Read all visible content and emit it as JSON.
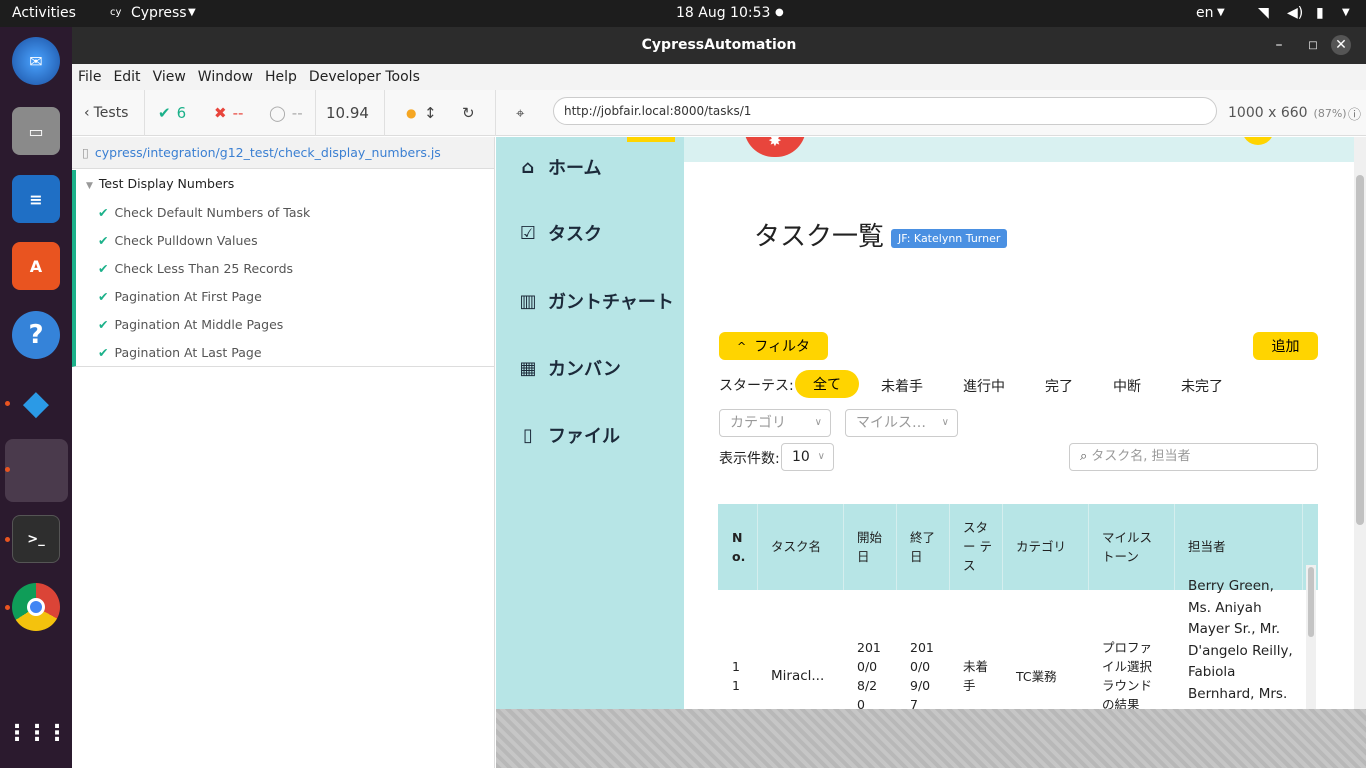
{
  "topbar": {
    "activities": "Activities",
    "app": "Cypress",
    "app_icon": "cy",
    "datetime": "18 Aug  10:53",
    "lang": "en"
  },
  "window": {
    "title": "CypressAutomation"
  },
  "menu": [
    "File",
    "Edit",
    "View",
    "Window",
    "Help",
    "Developer Tools"
  ],
  "toolbar": {
    "tests": "Tests",
    "passed": "6",
    "failed": "--",
    "pending": "--",
    "duration": "10.94",
    "url": "http://jobfair.local:8000/tasks/1",
    "viewport": "1000 x 660",
    "zoom": "(87%)"
  },
  "spec": {
    "path": "cypress/integration/g12_test/check_display_numbers.js",
    "suite": "Test Display Numbers",
    "tests": [
      "Check Default Numbers of Task",
      "Check Pulldown Values",
      "Check Less Than 25 Records",
      "Pagination At First Page",
      "Pagination At Middle Pages",
      "Pagination At Last Page"
    ]
  },
  "app": {
    "nav": [
      "ホーム",
      "タスク",
      "ガントチャート",
      "カンバン",
      "ファイル"
    ],
    "page_title": "タスク一覧",
    "jf_badge": "JF: Katelynn Turner",
    "filter_btn": "フィルタ",
    "add_btn": "追加",
    "status_label": "スターテス:",
    "statuses": [
      "全て",
      "未着手",
      "進行中",
      "完了",
      "中断",
      "未完了"
    ],
    "category_placeholder": "カテゴリ",
    "milestone_placeholder": "マイルス…",
    "per_page_label": "表示件数:",
    "per_page": "10",
    "search_placeholder": "タスク名, 担当者",
    "columns": [
      "N o.",
      "タスク名",
      "開始 日",
      "終了 日",
      "スター テス",
      "カテゴリ",
      "マイルス トーン",
      "担当者"
    ],
    "row": {
      "no": "1 1",
      "name": "Miracl...",
      "start": "201 0/0 8/2 0",
      "end": "201 0/0 9/0 7",
      "status": "未着 手",
      "category": "TC業務",
      "milestone": "プロファ イル選択 ラウンド の結果",
      "assignee": "Berry Green, Ms. Aniyah Mayer Sr., Mr. D'angelo Reilly, Fabiola Bernhard, Mrs."
    }
  },
  "colors": {
    "accent_yellow": "#ffd400",
    "teal": "#b7e5e6",
    "pass": "#1cb18a",
    "fail": "#e8453c",
    "badge": "#4a90e2"
  }
}
